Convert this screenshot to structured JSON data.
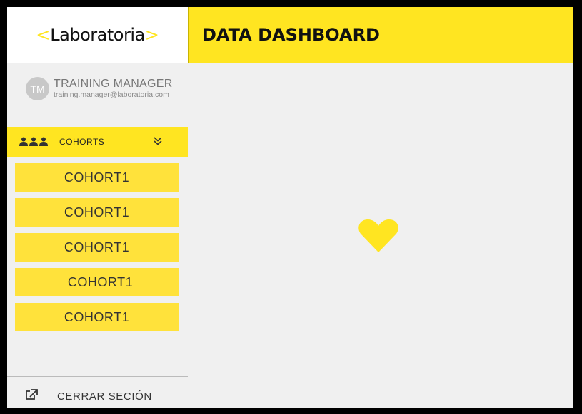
{
  "brand": {
    "logo_left": "<",
    "logo_text": "Laboratoria",
    "logo_right": ">",
    "accent_color": "#ffe521"
  },
  "header": {
    "title": "DATA DASHBOARD"
  },
  "user": {
    "initials": "TM",
    "name": "TRAINING MANAGER",
    "email": "training.manager@laboratoria.com"
  },
  "sidebar": {
    "section": {
      "icon": "people-icon",
      "label": "COHORTS",
      "toggle_icon": "double-chevron-down-icon"
    },
    "cohorts": [
      {
        "label": "COHORT1"
      },
      {
        "label": "COHORT1"
      },
      {
        "label": "COHORT1"
      },
      {
        "label": "COHORT1"
      },
      {
        "label": "COHORT1"
      }
    ],
    "logout": {
      "icon": "external-link-icon",
      "label": "CERRAR SECIÓN"
    }
  },
  "main": {
    "icon": "heart-icon"
  }
}
